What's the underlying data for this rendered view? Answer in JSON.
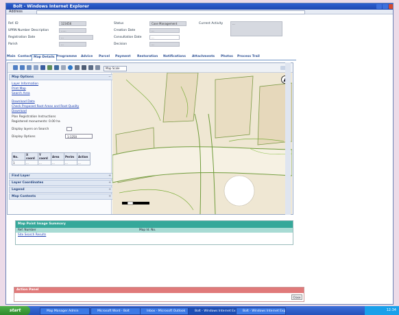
{
  "window": {
    "title": "Bolt - Windows Internet Explorer",
    "address_label": "Address",
    "address_value": "http://....."
  },
  "form": {
    "fields": [
      {
        "label": "Ref. ID",
        "value": "123456"
      },
      {
        "label": "UPRN Number Description",
        "value": "......"
      },
      {
        "label": "Registration Date",
        "value": "..."
      },
      {
        "label": "Parish",
        "value": "..."
      },
      {
        "label": "Status",
        "value": "Case Management"
      },
      {
        "label": "Creation Date",
        "value": "..."
      },
      {
        "label": "Consultation Date",
        "value": "..."
      },
      {
        "label": "Decision",
        "value": "..."
      },
      {
        "label": "Current Activity",
        "value": "..."
      }
    ]
  },
  "tabs": [
    "Main",
    "Contact",
    "Map Details",
    "Programme",
    "Advice",
    "Parcel",
    "Payment",
    "Restoration",
    "Notifications",
    "Attachments",
    "Photos",
    "Process Trail"
  ],
  "active_tab": "Map Details",
  "toolbar": {
    "scale_value": "Map Scale"
  },
  "side": {
    "map_header": "Map Options",
    "links": [
      "Layer Information",
      "Print Map",
      "Search Area"
    ],
    "links2": [
      "Download Data",
      "Check Proposed Root Areas and Root Quality",
      "Download"
    ],
    "texts": [
      "Plan Registration Instructions",
      "Registered monuments: 0.00 ha"
    ],
    "display_label": "Display layers on Search",
    "display_select_label": "Display Options",
    "display_select_value": "1:1250",
    "table_headers": [
      "No.",
      "X coord",
      "Y coord",
      "Area",
      "Perim",
      "Action"
    ],
    "table_row": [
      "1",
      "...",
      "...",
      "...",
      "...",
      "..."
    ],
    "panels": [
      "Find Layer",
      "Layer Coordinates",
      "Legend",
      "Map Contents"
    ]
  },
  "results": {
    "header": "Map Point Image Summary",
    "col1": "Ref. Number",
    "col2": "Map Id. No.",
    "row1": "Site Search Results"
  },
  "footer": {
    "header": "Action Panel",
    "button": "Close"
  },
  "taskbar": {
    "start": "start",
    "items": [
      "Map Manager Admin",
      "Microsoft Word - Bolt",
      "Inbox - Microsoft Outlook",
      "Bolt - Windows Internet Explorer",
      "Bolt - Windows Internet Explorer"
    ],
    "clock": "12:34"
  }
}
